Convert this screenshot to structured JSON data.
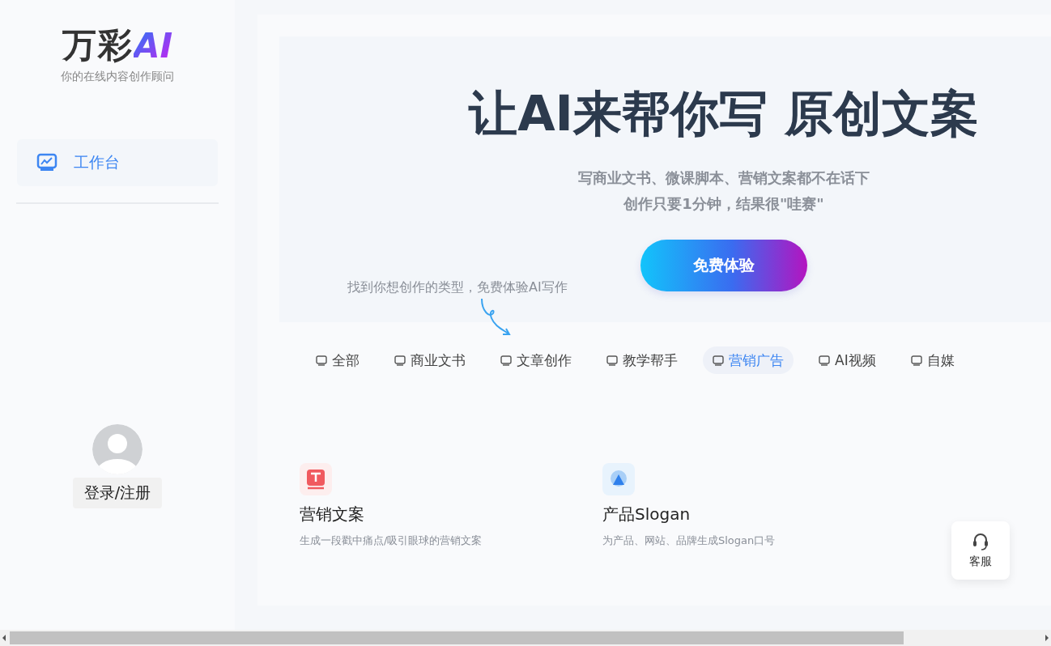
{
  "sidebar": {
    "logo": {
      "text": "万彩",
      "mark": "AI",
      "tagline": "你的在线内容创作顾问"
    },
    "nav": [
      {
        "label": "工作台",
        "selected": true
      }
    ],
    "login": "登录/注册"
  },
  "hero": {
    "title": "让AI来帮你写 原创文案",
    "lines": [
      "写商业文书、微课脚本、营销文案都不在话下",
      "创作只要1分钟，结果很\"哇赛\""
    ],
    "cta": "免费体验",
    "hint": "找到你想创作的类型，免费体验AI写作"
  },
  "categories": [
    {
      "label": "全部",
      "selected": false
    },
    {
      "label": "商业文书",
      "selected": false
    },
    {
      "label": "文章创作",
      "selected": false
    },
    {
      "label": "教学帮手",
      "selected": false
    },
    {
      "label": "营销广告",
      "selected": true
    },
    {
      "label": "AI视频",
      "selected": false
    },
    {
      "label": "自媒",
      "selected": false
    }
  ],
  "cards": [
    {
      "kind": "text",
      "title": "营销文案",
      "desc": "生成一段戳中痛点/吸引眼球的营销文案"
    },
    {
      "kind": "slogan",
      "title": "产品Slogan",
      "desc": "为产品、网站、品牌生成Slogan口号"
    }
  ],
  "support": {
    "label": "客服"
  }
}
